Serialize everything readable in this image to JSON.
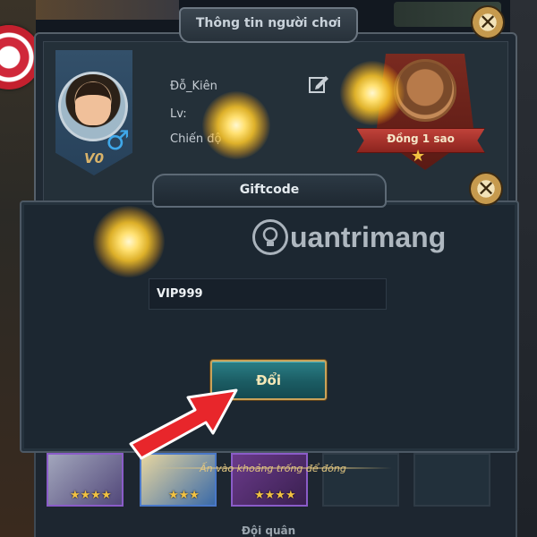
{
  "background": {
    "top_left_text": "Đồng 1 sao"
  },
  "player_info": {
    "title": "Thông tin người chơi",
    "close_label": "✕",
    "name": "Đỗ_Kiên",
    "level_label": "Lv:",
    "power_label": "Chiến độ",
    "vip_label": "V0",
    "gender_symbol": "♂",
    "rank": {
      "label": "Đồng 1 sao",
      "star": "★"
    }
  },
  "giftcode": {
    "title": "Giftcode",
    "close_label": "✕",
    "input_value": "VIP999",
    "submit_label": "Đổi"
  },
  "watermark": {
    "text": "uantrimang"
  },
  "team": {
    "hint": "Ấn vào khoảng trống để đóng",
    "label": "Đội quân",
    "hero_stars": [
      "★★★★",
      "★★★",
      "★★★★"
    ]
  },
  "colors": {
    "accent_teal": "#1b5c63",
    "gold_border": "#c9a25a",
    "arrow_red": "#e8262b",
    "gender_blue": "#3fa8ea"
  }
}
